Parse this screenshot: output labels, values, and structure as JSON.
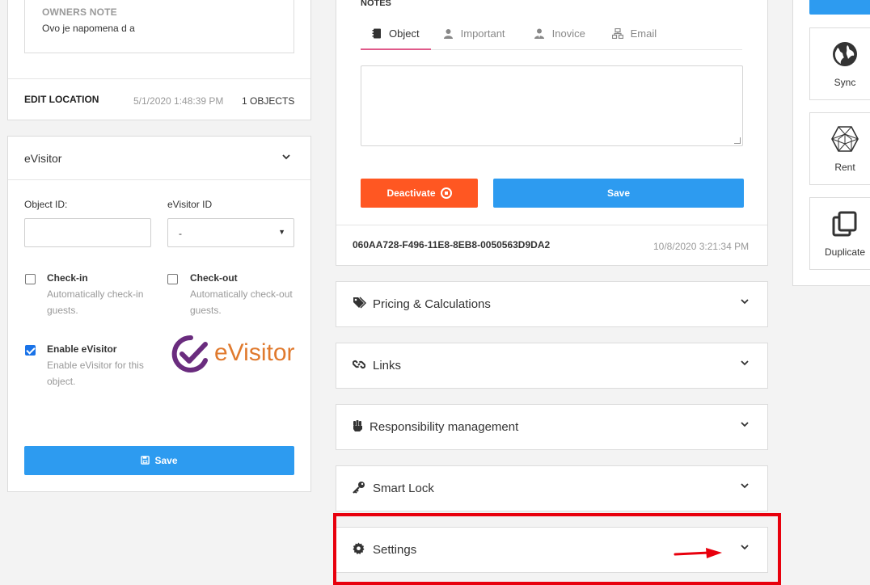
{
  "owners_note": {
    "title": "OWNERS NOTE",
    "text": "Ovo je napomena d a"
  },
  "location_footer": {
    "edit_label": "EDIT LOCATION",
    "date": "5/1/2020 1:48:39 PM",
    "objects": "1 OBJECTS"
  },
  "evisitor": {
    "title": "eVisitor",
    "object_id_label": "Object ID:",
    "object_id_value": "",
    "evisitor_id_label": "eVisitor ID",
    "evisitor_id_value": "-",
    "checkin_title": "Check-in",
    "checkin_desc": "Automatically check-in guests.",
    "checkin_checked": false,
    "checkout_title": "Check-out",
    "checkout_desc": "Automatically check-out guests.",
    "checkout_checked": false,
    "enable_title": "Enable eVisitor",
    "enable_desc": "Enable eVisitor for this object.",
    "enable_checked": true,
    "logo_text": "eVisitor",
    "save_label": "Save"
  },
  "notes": {
    "title": "NOTES",
    "tabs": [
      {
        "label": "Object",
        "icon": "notebook-icon",
        "active": true
      },
      {
        "label": "Important",
        "icon": "user-icon",
        "active": false
      },
      {
        "label": "Inovice",
        "icon": "user-tie-icon",
        "active": false
      },
      {
        "label": "Email",
        "icon": "sitemap-icon",
        "active": false
      }
    ],
    "textarea_value": "",
    "deactivate_label": "Deactivate",
    "save_label": "Save",
    "object_guid": "060AA728-F496-11E8-8EB8-0050563D9DA2",
    "object_date": "10/8/2020 3:21:34 PM"
  },
  "accordions": [
    {
      "label": "Pricing & Calculations",
      "icon": "tags-icon"
    },
    {
      "label": "Links",
      "icon": "link-icon"
    },
    {
      "label": "Responsibility management",
      "icon": "fist-icon"
    },
    {
      "label": "Smart Lock",
      "icon": "key-icon"
    },
    {
      "label": "Settings",
      "icon": "gear-icon"
    }
  ],
  "side_actions": [
    {
      "label": "Sync",
      "icon": "globe-icon"
    },
    {
      "label": "Rent",
      "icon": "polyhedron-icon"
    },
    {
      "label": "Duplicate",
      "icon": "copy-icon"
    }
  ],
  "colors": {
    "primary": "#2d9bf0",
    "danger": "#ff5722",
    "highlight": "#e8000d",
    "tab_active": "#e05a8a",
    "logo_orange": "#e07a2e",
    "logo_purple": "#6a2c7e"
  }
}
